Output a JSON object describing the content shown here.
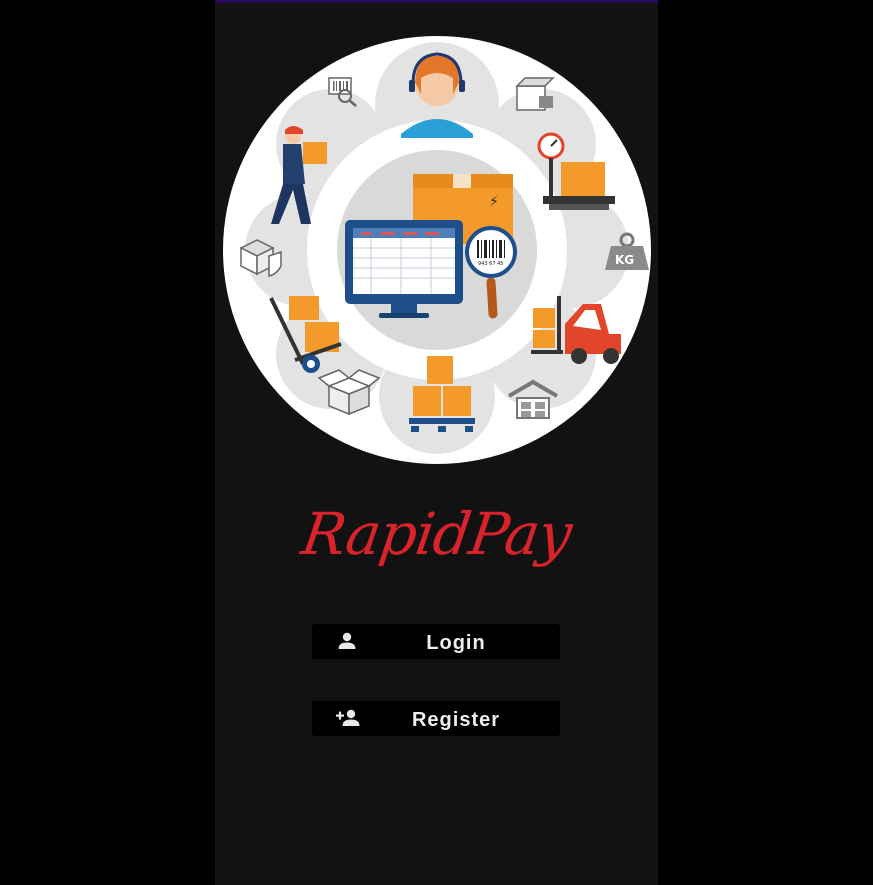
{
  "app": {
    "name": "RapidPay"
  },
  "actions": {
    "login_label": "Login",
    "register_label": "Register"
  },
  "illustration": {
    "kg_label": "KG",
    "barcode_text": "943 67 45"
  },
  "colors": {
    "background": "#121212",
    "brand_red": "#d8232b",
    "button_bg": "#000000",
    "button_text": "#eeeeee",
    "accent_orange": "#f39a2a",
    "monitor_blue": "#1e4f8a"
  },
  "icons": {
    "login": "person-icon",
    "register": "person-add-icon"
  }
}
